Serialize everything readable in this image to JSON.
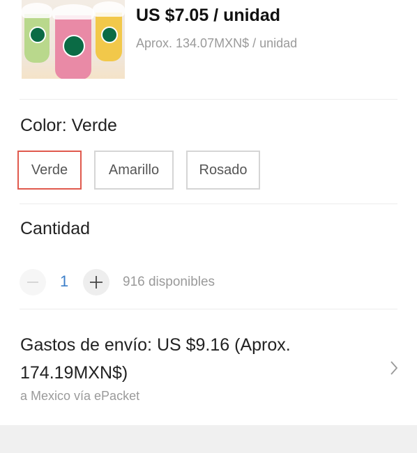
{
  "product": {
    "price": "US $7.05 / unidad",
    "price_approx": "Aprox. 134.07MXN$ / unidad",
    "image_colors": [
      "#b9d88c",
      "#e98aa6",
      "#f2c84a"
    ]
  },
  "color": {
    "title": "Color: Verde",
    "options": [
      "Verde",
      "Amarillo",
      "Rosado"
    ],
    "selected": "Verde",
    "selected_border_color": "#e0594d"
  },
  "quantity": {
    "title": "Cantidad",
    "value": "1",
    "available": "916 disponibles",
    "minus_icon": "minus-icon",
    "plus_icon": "plus-icon"
  },
  "shipping": {
    "cost": "Gastos de envío: US $9.16 (Aprox. 174.19MXN$)",
    "method": "a Mexico vía ePacket",
    "chevron_icon": "chevron-right-icon"
  }
}
